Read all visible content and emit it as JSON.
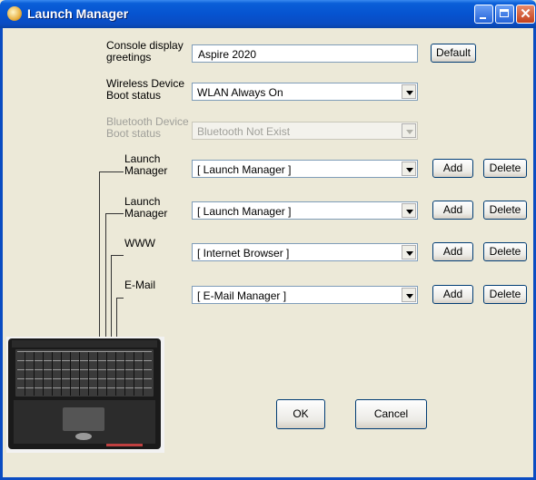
{
  "window": {
    "title": "Launch Manager"
  },
  "console": {
    "label_line1": "Console display",
    "label_line2": "greetings",
    "value": "Aspire 2020",
    "default_button": "Default"
  },
  "wireless": {
    "label_line1": "Wireless Device",
    "label_line2": "Boot status",
    "value": "WLAN Always On"
  },
  "bluetooth": {
    "label_line1": "Bluetooth Device",
    "label_line2": "Boot status",
    "value": "Bluetooth Not Exist"
  },
  "keys": [
    {
      "label_line1": "Launch",
      "label_line2": "Manager",
      "value": "[  Launch Manager  ]",
      "add": "Add",
      "delete": "Delete"
    },
    {
      "label_line1": "Launch",
      "label_line2": "Manager",
      "value": "[  Launch Manager  ]",
      "add": "Add",
      "delete": "Delete"
    },
    {
      "label_line1": "WWW",
      "label_line2": "",
      "value": "[  Internet Browser  ]",
      "add": "Add",
      "delete": "Delete"
    },
    {
      "label_line1": "E-Mail",
      "label_line2": "",
      "value": "[  E-Mail Manager  ]",
      "add": "Add",
      "delete": "Delete"
    }
  ],
  "buttons": {
    "ok": "OK",
    "cancel": "Cancel"
  },
  "colors": {
    "titlebar": "#0a5fd8",
    "face": "#ece9d8",
    "field_border": "#7f9db9"
  },
  "icons": {
    "app": "launch-manager-app-icon",
    "minimize": "minimize-icon",
    "maximize": "maximize-icon",
    "close": "close-icon",
    "laptop": "laptop-keyboard-image"
  }
}
